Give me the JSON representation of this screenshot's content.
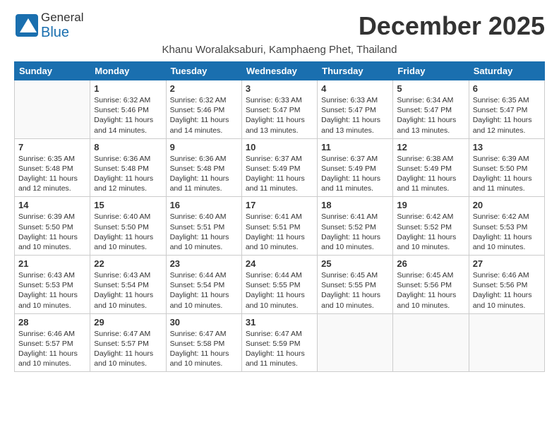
{
  "header": {
    "logo_general": "General",
    "logo_blue": "Blue",
    "month_title": "December 2025",
    "subtitle": "Khanu Woralaksaburi, Kamphaeng Phet, Thailand"
  },
  "days_of_week": [
    "Sunday",
    "Monday",
    "Tuesday",
    "Wednesday",
    "Thursday",
    "Friday",
    "Saturday"
  ],
  "weeks": [
    [
      {
        "num": "",
        "info": ""
      },
      {
        "num": "1",
        "info": "Sunrise: 6:32 AM\nSunset: 5:46 PM\nDaylight: 11 hours\nand 14 minutes."
      },
      {
        "num": "2",
        "info": "Sunrise: 6:32 AM\nSunset: 5:46 PM\nDaylight: 11 hours\nand 14 minutes."
      },
      {
        "num": "3",
        "info": "Sunrise: 6:33 AM\nSunset: 5:47 PM\nDaylight: 11 hours\nand 13 minutes."
      },
      {
        "num": "4",
        "info": "Sunrise: 6:33 AM\nSunset: 5:47 PM\nDaylight: 11 hours\nand 13 minutes."
      },
      {
        "num": "5",
        "info": "Sunrise: 6:34 AM\nSunset: 5:47 PM\nDaylight: 11 hours\nand 13 minutes."
      },
      {
        "num": "6",
        "info": "Sunrise: 6:35 AM\nSunset: 5:47 PM\nDaylight: 11 hours\nand 12 minutes."
      }
    ],
    [
      {
        "num": "7",
        "info": "Sunrise: 6:35 AM\nSunset: 5:48 PM\nDaylight: 11 hours\nand 12 minutes."
      },
      {
        "num": "8",
        "info": "Sunrise: 6:36 AM\nSunset: 5:48 PM\nDaylight: 11 hours\nand 12 minutes."
      },
      {
        "num": "9",
        "info": "Sunrise: 6:36 AM\nSunset: 5:48 PM\nDaylight: 11 hours\nand 11 minutes."
      },
      {
        "num": "10",
        "info": "Sunrise: 6:37 AM\nSunset: 5:49 PM\nDaylight: 11 hours\nand 11 minutes."
      },
      {
        "num": "11",
        "info": "Sunrise: 6:37 AM\nSunset: 5:49 PM\nDaylight: 11 hours\nand 11 minutes."
      },
      {
        "num": "12",
        "info": "Sunrise: 6:38 AM\nSunset: 5:49 PM\nDaylight: 11 hours\nand 11 minutes."
      },
      {
        "num": "13",
        "info": "Sunrise: 6:39 AM\nSunset: 5:50 PM\nDaylight: 11 hours\nand 11 minutes."
      }
    ],
    [
      {
        "num": "14",
        "info": "Sunrise: 6:39 AM\nSunset: 5:50 PM\nDaylight: 11 hours\nand 10 minutes."
      },
      {
        "num": "15",
        "info": "Sunrise: 6:40 AM\nSunset: 5:50 PM\nDaylight: 11 hours\nand 10 minutes."
      },
      {
        "num": "16",
        "info": "Sunrise: 6:40 AM\nSunset: 5:51 PM\nDaylight: 11 hours\nand 10 minutes."
      },
      {
        "num": "17",
        "info": "Sunrise: 6:41 AM\nSunset: 5:51 PM\nDaylight: 11 hours\nand 10 minutes."
      },
      {
        "num": "18",
        "info": "Sunrise: 6:41 AM\nSunset: 5:52 PM\nDaylight: 11 hours\nand 10 minutes."
      },
      {
        "num": "19",
        "info": "Sunrise: 6:42 AM\nSunset: 5:52 PM\nDaylight: 11 hours\nand 10 minutes."
      },
      {
        "num": "20",
        "info": "Sunrise: 6:42 AM\nSunset: 5:53 PM\nDaylight: 11 hours\nand 10 minutes."
      }
    ],
    [
      {
        "num": "21",
        "info": "Sunrise: 6:43 AM\nSunset: 5:53 PM\nDaylight: 11 hours\nand 10 minutes."
      },
      {
        "num": "22",
        "info": "Sunrise: 6:43 AM\nSunset: 5:54 PM\nDaylight: 11 hours\nand 10 minutes."
      },
      {
        "num": "23",
        "info": "Sunrise: 6:44 AM\nSunset: 5:54 PM\nDaylight: 11 hours\nand 10 minutes."
      },
      {
        "num": "24",
        "info": "Sunrise: 6:44 AM\nSunset: 5:55 PM\nDaylight: 11 hours\nand 10 minutes."
      },
      {
        "num": "25",
        "info": "Sunrise: 6:45 AM\nSunset: 5:55 PM\nDaylight: 11 hours\nand 10 minutes."
      },
      {
        "num": "26",
        "info": "Sunrise: 6:45 AM\nSunset: 5:56 PM\nDaylight: 11 hours\nand 10 minutes."
      },
      {
        "num": "27",
        "info": "Sunrise: 6:46 AM\nSunset: 5:56 PM\nDaylight: 11 hours\nand 10 minutes."
      }
    ],
    [
      {
        "num": "28",
        "info": "Sunrise: 6:46 AM\nSunset: 5:57 PM\nDaylight: 11 hours\nand 10 minutes."
      },
      {
        "num": "29",
        "info": "Sunrise: 6:47 AM\nSunset: 5:57 PM\nDaylight: 11 hours\nand 10 minutes."
      },
      {
        "num": "30",
        "info": "Sunrise: 6:47 AM\nSunset: 5:58 PM\nDaylight: 11 hours\nand 10 minutes."
      },
      {
        "num": "31",
        "info": "Sunrise: 6:47 AM\nSunset: 5:59 PM\nDaylight: 11 hours\nand 11 minutes."
      },
      {
        "num": "",
        "info": ""
      },
      {
        "num": "",
        "info": ""
      },
      {
        "num": "",
        "info": ""
      }
    ]
  ]
}
